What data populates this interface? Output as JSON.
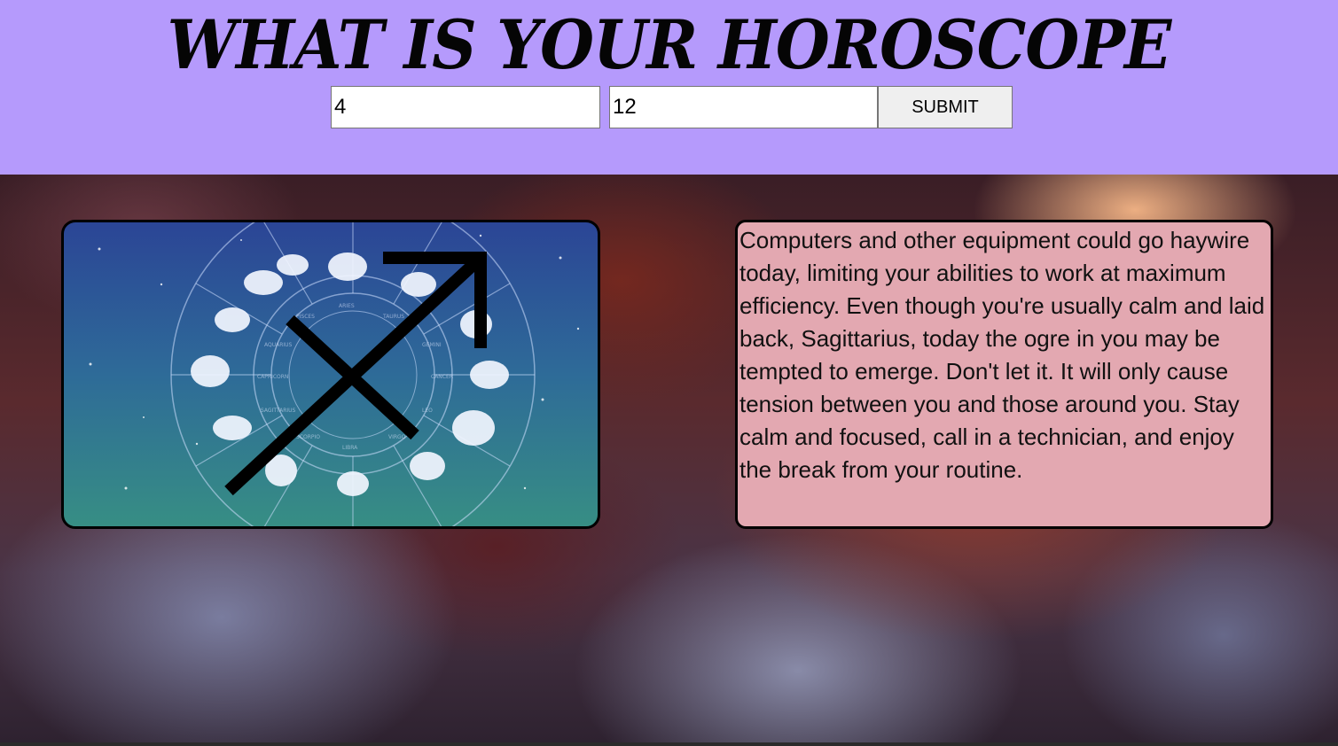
{
  "header": {
    "title": "WHAT IS YOUR HOROSCOPE",
    "month_value": "4",
    "day_value": "12",
    "submit_label": "SUBMIT"
  },
  "sign_image": {
    "icon": "sagittarius-symbol-icon",
    "wheel_labels": [
      "ARIES",
      "TAURUS",
      "GEMINI",
      "CANCER",
      "LEO",
      "VIRGO",
      "LIBRA",
      "SCORPIO",
      "SAGITTARIUS",
      "CAPRICORN",
      "AQUARIUS",
      "PISCES"
    ]
  },
  "horoscope": {
    "text": "Computers and other equipment could go haywire today, limiting your abilities to work at maximum efficiency. Even though you're usually calm and laid back, Sagittarius, today the ogre in you may be tempted to emerge. Don't let it. It will only cause tension between you and those around you. Stay calm and focused, call in a technician, and enjoy the break from your routine."
  },
  "colors": {
    "header_bg": "#b59afc",
    "text_card_bg": "#e3a8b1",
    "image_bg_top": "#2b4596",
    "image_bg_bottom": "#378e84"
  }
}
